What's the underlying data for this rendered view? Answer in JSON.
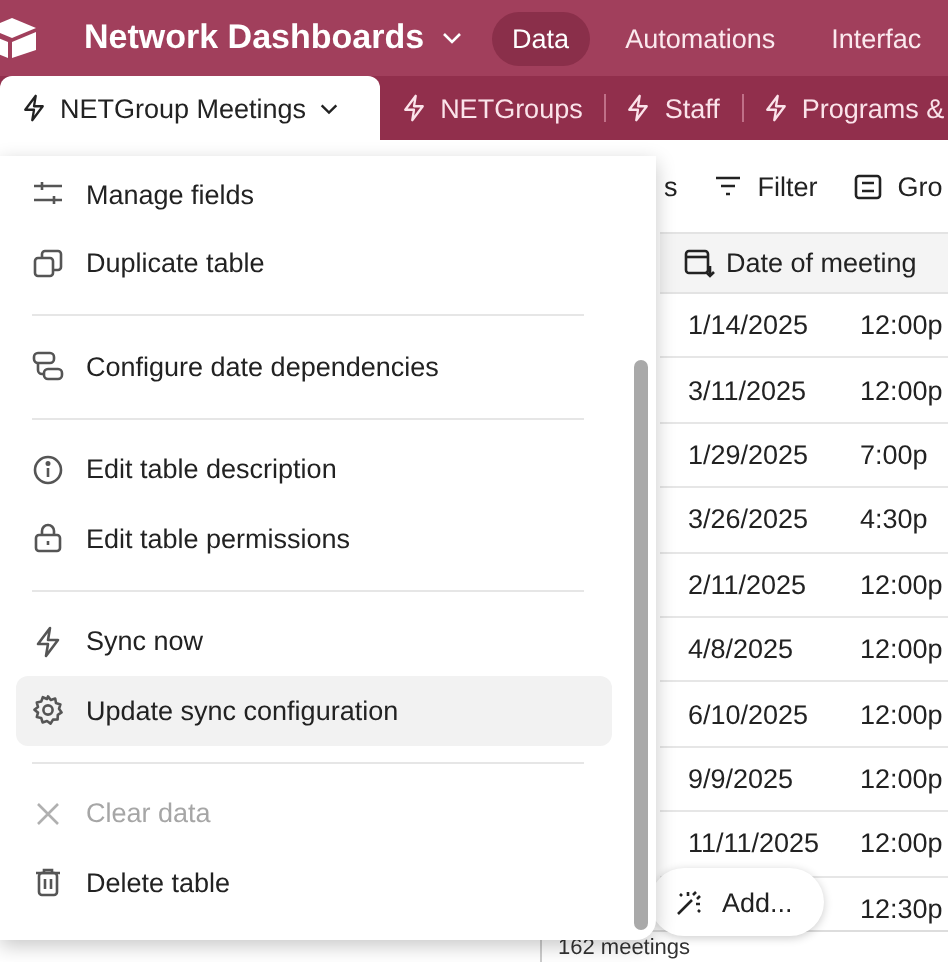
{
  "app_bar": {
    "base_name": "Network Dashboards",
    "nav": [
      {
        "label": "Data",
        "selected": true
      },
      {
        "label": "Automations",
        "selected": false
      },
      {
        "label": "Interfac",
        "selected": false
      }
    ]
  },
  "table_tabs": [
    {
      "label": "NETGroup Meetings",
      "selected": true
    },
    {
      "label": "NETGroups",
      "selected": false
    },
    {
      "label": "Staff",
      "selected": false
    },
    {
      "label": "Programs &",
      "selected": false
    }
  ],
  "toolbar": {
    "hidden_fields_fragment": "s",
    "filter": "Filter",
    "group": "Gro"
  },
  "grid": {
    "columns": [
      "Date of meeting"
    ],
    "rows": [
      {
        "date": "1/14/2025",
        "time": "12:00p"
      },
      {
        "date": "3/11/2025",
        "time": "12:00p"
      },
      {
        "date": "1/29/2025",
        "time": "7:00p"
      },
      {
        "date": "3/26/2025",
        "time": "4:30p"
      },
      {
        "date": "2/11/2025",
        "time": "12:00p"
      },
      {
        "date": "4/8/2025",
        "time": "12:00p"
      },
      {
        "date": "6/10/2025",
        "time": "12:00p"
      },
      {
        "date": "9/9/2025",
        "time": "12:00p"
      },
      {
        "date": "11/11/2025",
        "time": "12:00p"
      },
      {
        "time": "12:30p"
      }
    ],
    "add_button": "Add...",
    "record_count": "162 meetings"
  },
  "menu": {
    "groups": [
      [
        {
          "label": "Manage fields",
          "disabled": false,
          "selected": false
        },
        {
          "label": "Duplicate table",
          "disabled": false,
          "selected": false
        }
      ],
      [
        {
          "label": "Configure date dependencies",
          "disabled": false,
          "selected": false
        }
      ],
      [
        {
          "label": "Edit table description",
          "disabled": false,
          "selected": false
        },
        {
          "label": "Edit table permissions",
          "disabled": false,
          "selected": false
        }
      ],
      [
        {
          "label": "Sync now",
          "disabled": false,
          "selected": false
        },
        {
          "label": "Update sync configuration",
          "disabled": false,
          "selected": true
        }
      ],
      [
        {
          "label": "Clear data",
          "disabled": true,
          "selected": false
        },
        {
          "label": "Delete table",
          "disabled": false,
          "selected": false
        }
      ]
    ]
  }
}
